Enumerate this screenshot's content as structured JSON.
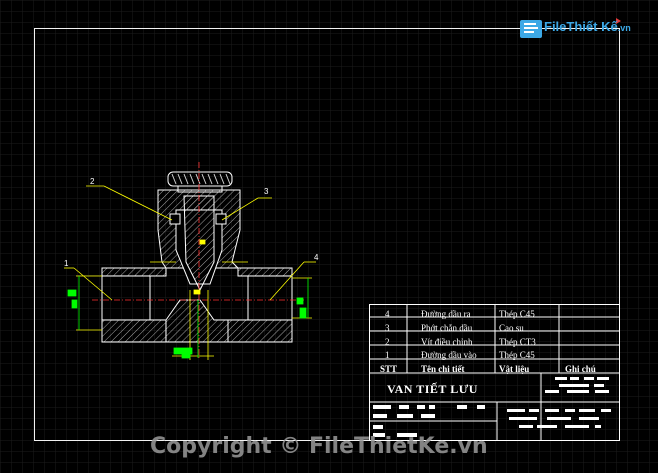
{
  "watermark": {
    "brand_prefix": "File",
    "brand_name": "Thiết Kế",
    "brand_domain": ".vn",
    "copyright_text": "Copyright © FileThietKe.vn",
    "brand_color": "#3ca8e6"
  },
  "drawing": {
    "title": "VAN TIẾT LƯU",
    "balloons": [
      "1",
      "2",
      "3",
      "4"
    ]
  },
  "parts_table": {
    "columns": [
      "STT",
      "Tên chi tiết",
      "Vật liệu",
      "Ghi chú"
    ],
    "rows": [
      {
        "stt": "4",
        "name": "Đường dầu ra",
        "material": "Thép C45",
        "note": ""
      },
      {
        "stt": "3",
        "name": "Phớt chắn dầu",
        "material": "Cao su",
        "note": ""
      },
      {
        "stt": "2",
        "name": "Vít điều chỉnh",
        "material": "Thép CT3",
        "note": ""
      },
      {
        "stt": "1",
        "name": "Đường dầu vào",
        "material": "Thép C45",
        "note": ""
      }
    ]
  },
  "colors": {
    "background": "#000000",
    "lines": "#ffffff",
    "leaders": "#ffff00",
    "dimensions": "#00ff00",
    "centerlines": "#ff3030"
  }
}
